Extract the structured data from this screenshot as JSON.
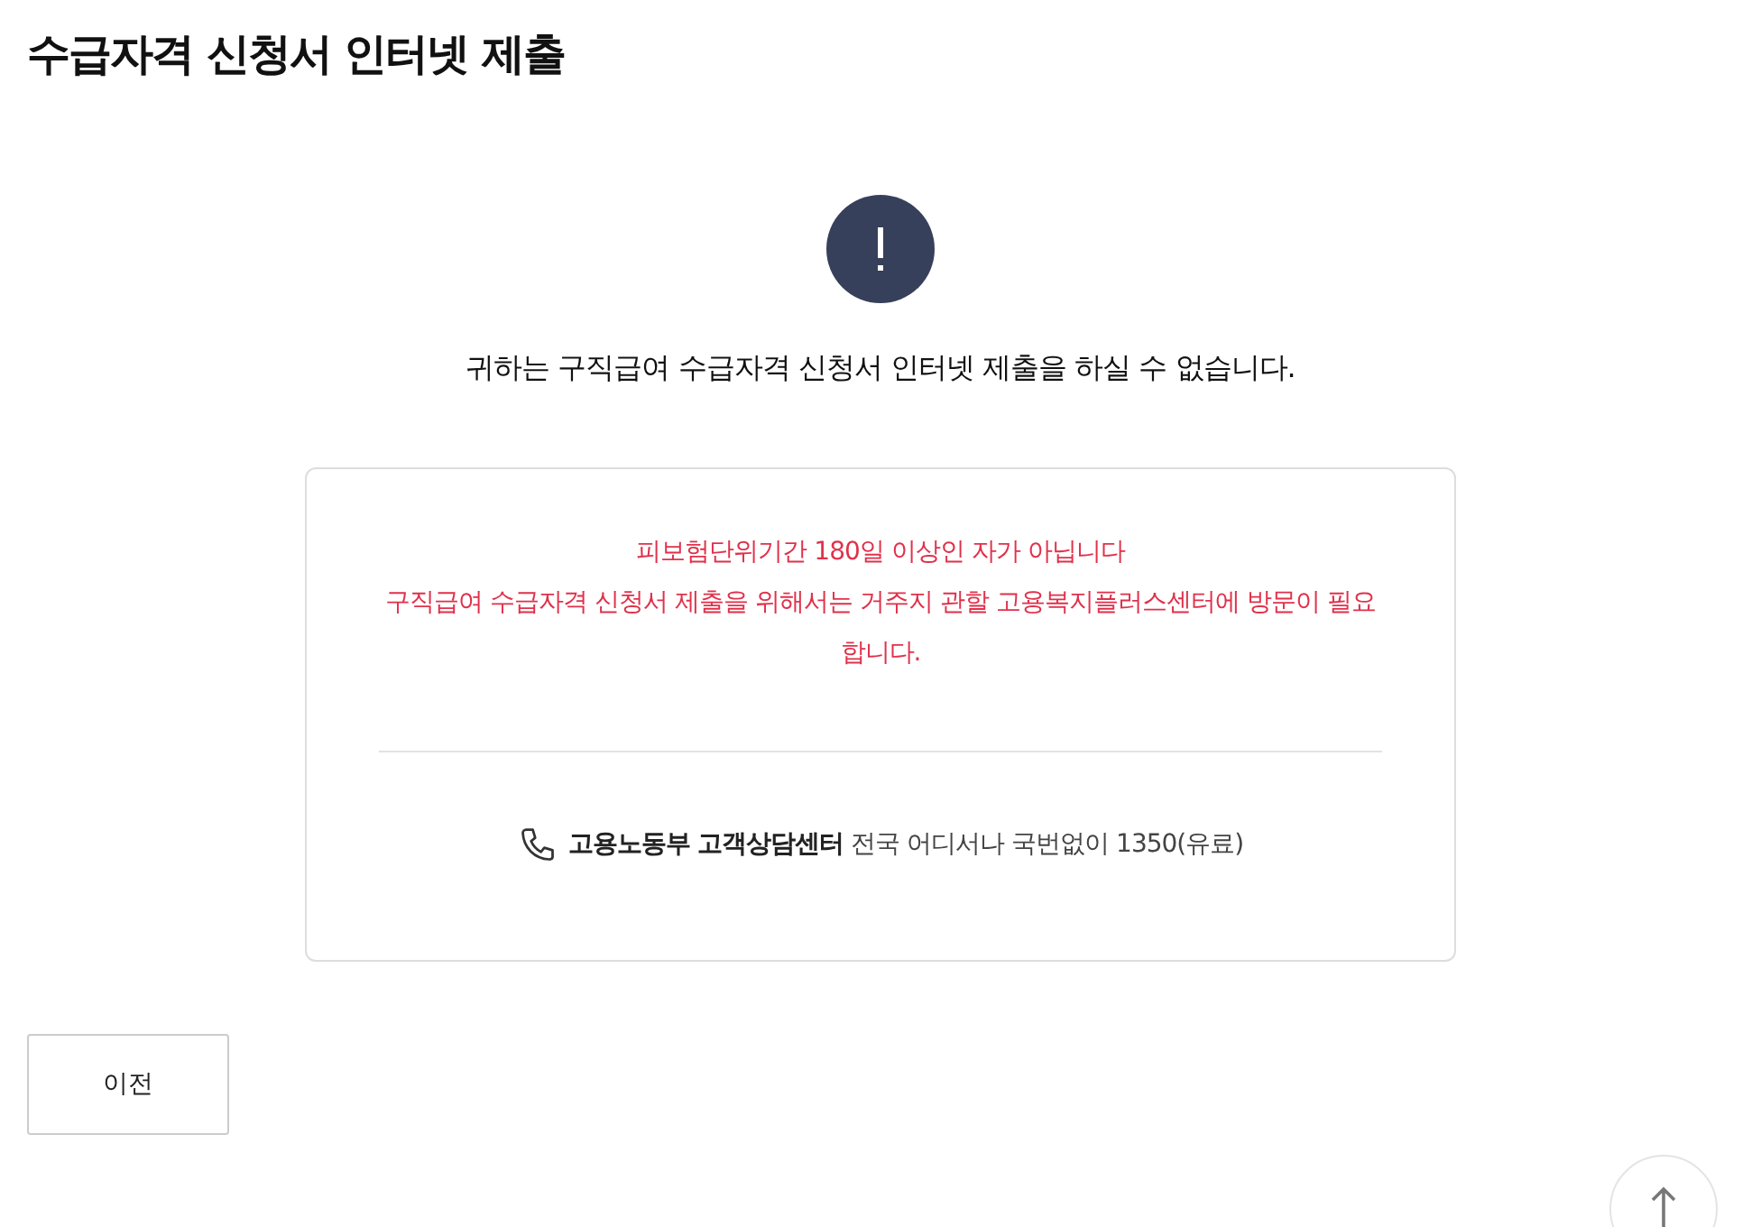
{
  "page_title": "수급자격 신청서 인터넷 제출",
  "notice": {
    "message": "귀하는 구직급여 수급자격 신청서 인터넷 제출을 하실 수 없습니다.",
    "errors": [
      "피보험단위기간 180일 이상인 자가 아닙니다",
      "구직급여 수급자격 신청서 제출을 위해서는 거주지 관할 고용복지플러스센터에 방문이 필요합니다."
    ],
    "contact": "**고용노동부 고객상담센터** 전국 어디서나 국번없이 1350(유료)"
  },
  "buttons": [
    "이전"
  ]
}
